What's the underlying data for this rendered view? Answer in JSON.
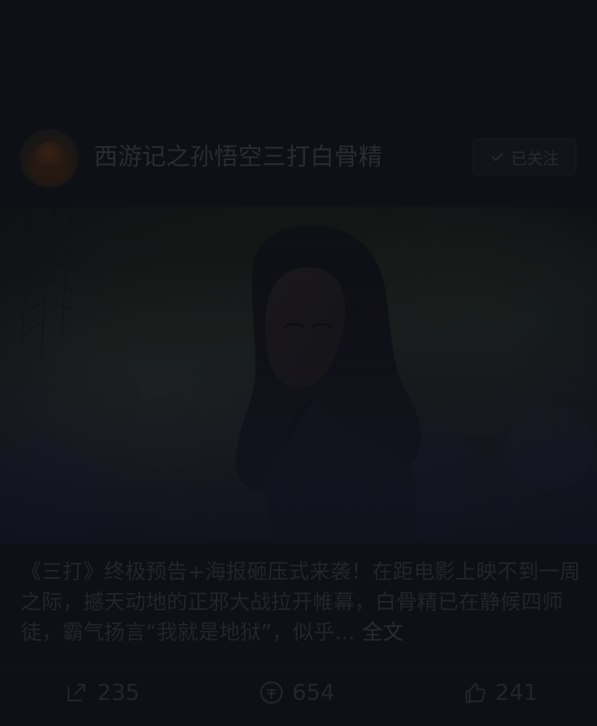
{
  "post": {
    "author_name": "西游记之孙悟空三打白骨精",
    "follow_label": "已关注",
    "caption_text": "《三打》终极预告+海报砸压式来袭！在距电影上映不到一周之际，撼天动地的正邪大战拉开帷幕，白骨精已在静候四师徒，霸气扬言“我就是地狱”，似乎… ",
    "full_text_link": "全文",
    "share_count": "235",
    "reward_count": "654",
    "like_count": "241"
  },
  "icons": {
    "follow": "check-icon",
    "share": "share-icon",
    "reward": "reward-icon",
    "like": "thumbs-up-icon"
  },
  "colors": {
    "background": "#0f1015",
    "dim_text": "#23252b"
  }
}
